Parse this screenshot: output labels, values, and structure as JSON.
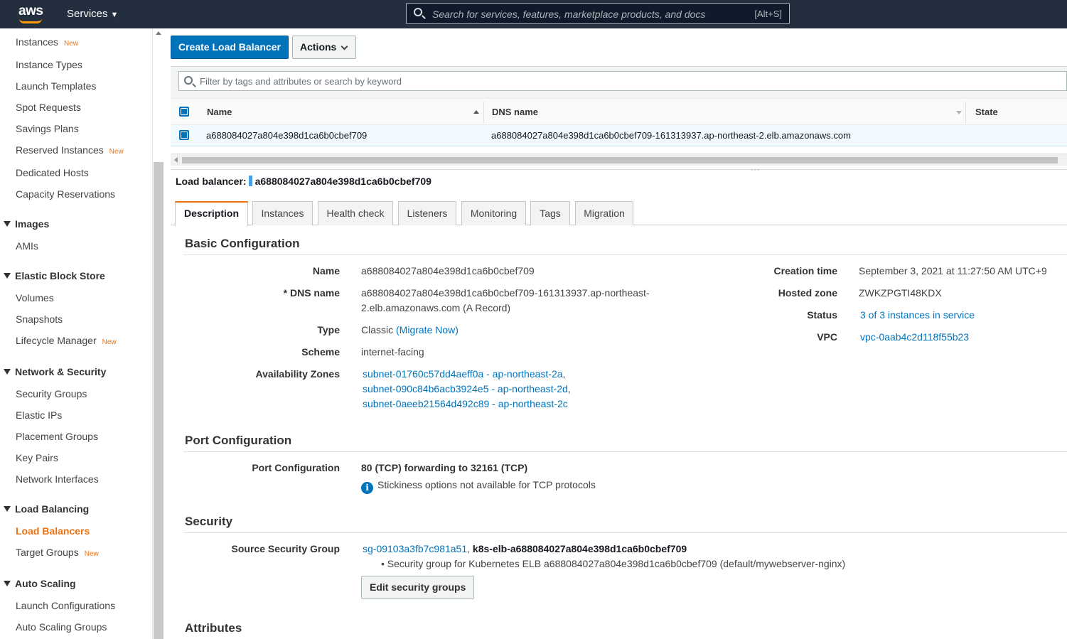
{
  "topnav": {
    "logo": "aws",
    "services_label": "Services",
    "search_placeholder": "Search for services, features, marketplace products, and docs",
    "search_shortcut": "[Alt+S]"
  },
  "sidebar": {
    "new_badge": "New",
    "instances": "Instances",
    "instance_types": "Instance Types",
    "launch_templates": "Launch Templates",
    "spot_requests": "Spot Requests",
    "savings_plans": "Savings Plans",
    "reserved_instances": "Reserved Instances",
    "dedicated_hosts": "Dedicated Hosts",
    "capacity_reservations": "Capacity Reservations",
    "images": "Images",
    "amis": "AMIs",
    "ebs": "Elastic Block Store",
    "volumes": "Volumes",
    "snapshots": "Snapshots",
    "lifecycle_manager": "Lifecycle Manager",
    "network_security": "Network & Security",
    "security_groups": "Security Groups",
    "elastic_ips": "Elastic IPs",
    "placement_groups": "Placement Groups",
    "key_pairs": "Key Pairs",
    "network_interfaces": "Network Interfaces",
    "load_balancing": "Load Balancing",
    "load_balancers": "Load Balancers",
    "target_groups": "Target Groups",
    "auto_scaling": "Auto Scaling",
    "launch_configurations": "Launch Configurations",
    "auto_scaling_groups": "Auto Scaling Groups"
  },
  "toolbar": {
    "create_label": "Create Load Balancer",
    "actions_label": "Actions",
    "filter_placeholder": "Filter by tags and attributes or search by keyword"
  },
  "table": {
    "headers": {
      "name": "Name",
      "dns": "DNS name",
      "state": "State"
    },
    "rows": [
      {
        "name": "a688084027a804e398d1ca6b0cbef709",
        "dns": "a688084027a804e398d1ca6b0cbef709-161313937.ap-northeast-2.elb.amazonaws.com",
        "state": ""
      }
    ]
  },
  "detail": {
    "lb_label": "Load balancer:",
    "lb_name": "a688084027a804e398d1ca6b0cbef709",
    "tabs": [
      "Description",
      "Instances",
      "Health check",
      "Listeners",
      "Monitoring",
      "Tags",
      "Migration"
    ],
    "basic": {
      "title": "Basic Configuration",
      "name_label": "Name",
      "name_value": "a688084027a804e398d1ca6b0cbef709",
      "dns_label": "* DNS name",
      "dns_value_line1": "a688084027a804e398d1ca6b0cbef709-161313937.ap-northeast-",
      "dns_value_line2": "2.elb.amazonaws.com (A Record)",
      "type_label": "Type",
      "type_value": "Classic",
      "type_link": "(Migrate Now)",
      "scheme_label": "Scheme",
      "scheme_value": "internet-facing",
      "az_label": "Availability Zones",
      "az": [
        "subnet-01760c57dd4aeff0a - ap-northeast-2a",
        "subnet-090c84b6acb3924e5 - ap-northeast-2d",
        "subnet-0aeeb21564d492c89 - ap-northeast-2c"
      ],
      "az_sep": ",",
      "creation_label": "Creation time",
      "creation_value": "September 3, 2021 at 11:27:50 AM UTC+9",
      "zone_label": "Hosted zone",
      "zone_value": "ZWKZPGTI48KDX",
      "status_label": "Status",
      "status_value": "3 of 3 instances in service",
      "vpc_label": "VPC",
      "vpc_value": "vpc-0aab4c2d118f55b23"
    },
    "port": {
      "title": "Port Configuration",
      "label": "Port Configuration",
      "value": "80 (TCP) forwarding to 32161 (TCP)",
      "info": "Stickiness options not available for TCP protocols",
      "info_icon": "i"
    },
    "security": {
      "title": "Security",
      "label": "Source Security Group",
      "sg_id": "sg-09103a3fb7c981a51",
      "sg_sep": ",",
      "sg_name": "k8s-elb-a688084027a804e398d1ca6b0cbef709",
      "sg_desc": "• Security group for Kubernetes ELB a688084027a804e398d1ca6b0cbef709 (default/mywebserver-nginx)",
      "edit_button": "Edit security groups"
    },
    "attributes": {
      "title": "Attributes"
    }
  },
  "colors": {
    "nav_bg": "#232f3e",
    "accent": "#ec7211",
    "primary": "#0073bb"
  }
}
